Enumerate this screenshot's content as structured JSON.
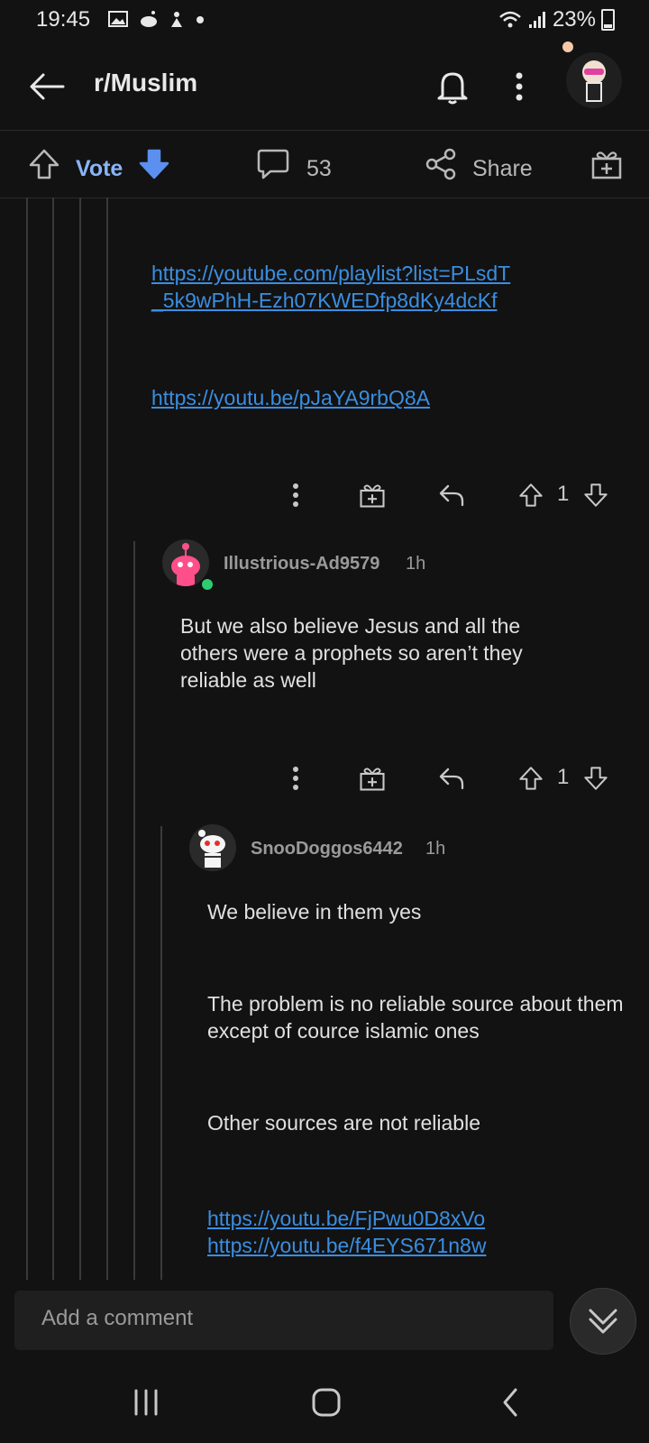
{
  "status_bar": {
    "time": "19:45",
    "battery": "23%"
  },
  "header": {
    "title": "r/Muslim"
  },
  "action_bar": {
    "vote_label": "Vote",
    "comment_count": "53",
    "share_label": "Share"
  },
  "comment1": {
    "links": [
      "https://youtube.com/playlist?list=PLsdT_5k9wPhH-Ezh07KWEDfp8dKy4dcKf",
      "https://youtu.be/pJaYA9rbQ8A"
    ],
    "link1_line1": "https://youtube.com/playlist?list=PLsdT",
    "link1_line2": "_5k9wPhH-Ezh07KWEDfp8dKy4dcKf",
    "link2": "https://youtu.be/pJaYA9rbQ8A",
    "votes": "1"
  },
  "comment2": {
    "username": "Illustrious-Ad9579",
    "age": "1h",
    "text": "But we also believe Jesus and all the others were a prophets so aren’t they reliable as well",
    "votes": "1"
  },
  "comment3": {
    "username": "SnooDoggos6442",
    "age": "1h",
    "p1": "We believe in them yes",
    "p2": "The problem is no reliable source about them except of cource islamic ones",
    "p3": "Other sources are not reliable",
    "link1": "https://youtu.be/FjPwu0D8xVo",
    "link2": "https://youtu.be/f4EYS671n8w"
  },
  "comment_input": {
    "placeholder": "Add a comment"
  },
  "colors": {
    "background": "#121212",
    "link": "#3b8ee0",
    "vote_blue": "#8ab4f8",
    "online": "#2ecc71"
  }
}
